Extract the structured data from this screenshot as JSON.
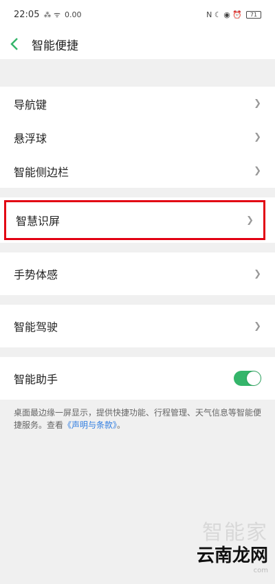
{
  "status_bar": {
    "time": "22:05",
    "left_icons_text": "⁂ ᯤ",
    "speed": "0.00",
    "right_icons_text": "N ☾ ◉ ⏰",
    "battery": "71"
  },
  "header": {
    "title": "智能便捷"
  },
  "items": [
    {
      "label": "导航键"
    },
    {
      "label": "悬浮球"
    },
    {
      "label": "智能侧边栏"
    },
    {
      "label": "智慧识屏"
    },
    {
      "label": "手势体感"
    },
    {
      "label": "智能驾驶"
    },
    {
      "label": "智能助手"
    }
  ],
  "assistant_toggle": {
    "on": true
  },
  "description": {
    "text": "桌面最边缘一屏显示，提供快捷功能、行程管理、天气信息等智能便捷服务。查看",
    "link": "《声明与条款》",
    "end": "。"
  },
  "watermark": {
    "line1": "智能家",
    "line2": "云南龙网",
    "line3": "com"
  },
  "colors": {
    "accent": "#34b56a",
    "highlight": "#e20012",
    "link": "#2f7de1"
  }
}
